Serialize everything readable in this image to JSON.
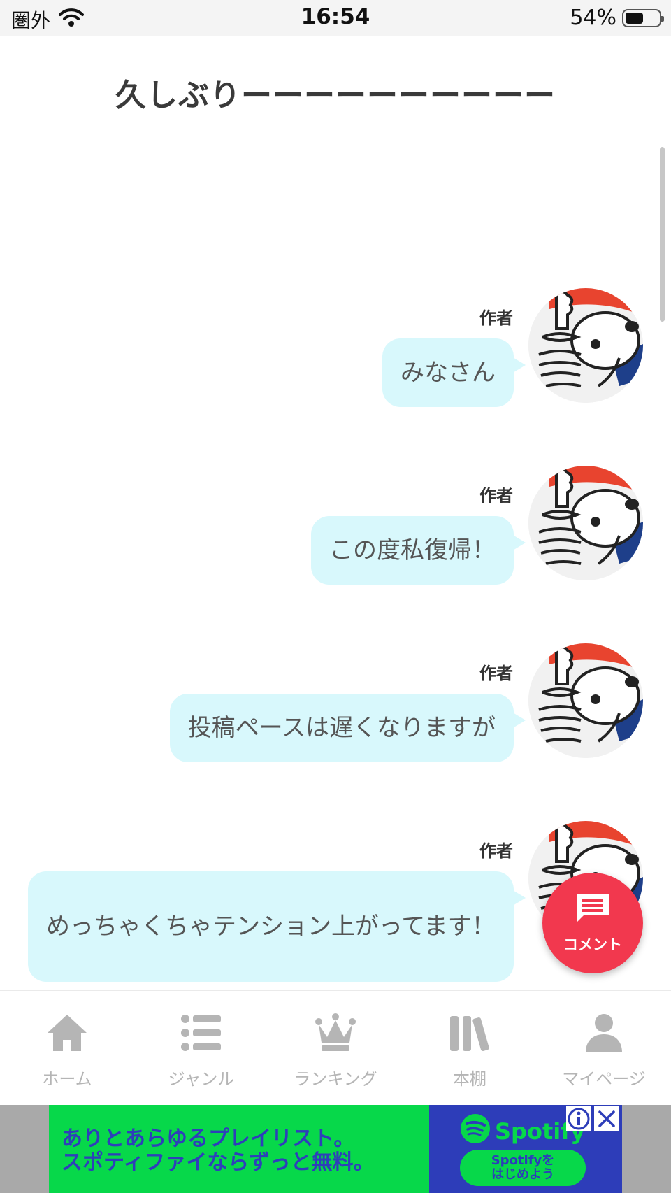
{
  "status_bar": {
    "carrier": "圏外",
    "time": "16:54",
    "battery": "54%",
    "battery_level": 0.54
  },
  "title": "久しぶりーーーーーーーーーー",
  "messages": [
    {
      "author": "作者",
      "text": "みなさん"
    },
    {
      "author": "作者",
      "text": "この度私復帰！"
    },
    {
      "author": "作者",
      "text": "投稿ペースは遅くなりますが"
    },
    {
      "author": "作者",
      "text": "めっちゃくちゃテンション上がってます！"
    }
  ],
  "fab": {
    "label": "コメント",
    "icon": "comment-icon"
  },
  "nav": [
    {
      "label": "ホーム",
      "icon": "home-icon"
    },
    {
      "label": "ジャンル",
      "icon": "list-icon"
    },
    {
      "label": "ランキング",
      "icon": "crown-icon"
    },
    {
      "label": "本棚",
      "icon": "bookshelf-icon"
    },
    {
      "label": "マイページ",
      "icon": "person-icon"
    }
  ],
  "ad": {
    "line1": "ありとあらゆるプレイリスト。",
    "line2": "スポティファイならずっと無料。",
    "brand": "Spotify",
    "cta_line1": "Spotifyを",
    "cta_line2": "はじめよう"
  },
  "colors": {
    "bubble": "#d8f8fc",
    "fab": "#f2384e",
    "nav_inactive": "#b5b5b5",
    "ad_green": "#07d84a",
    "ad_blue": "#2d3db9"
  }
}
